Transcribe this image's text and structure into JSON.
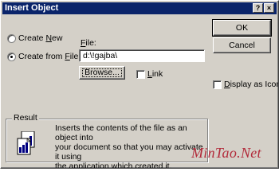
{
  "window": {
    "title": "Insert Object",
    "help_button": "?",
    "close_button": "×"
  },
  "buttons": {
    "ok": "OK",
    "cancel": "Cancel",
    "browse": "Browse..."
  },
  "options": {
    "create_new": {
      "prefix": "Create ",
      "accel": "N",
      "suffix": "ew",
      "selected": false
    },
    "create_from_file": {
      "prefix": "Create from ",
      "accel": "F",
      "suffix": "ile",
      "selected": true
    }
  },
  "file": {
    "label_accel": "F",
    "label_rest": "ile:",
    "value": "d:\\!gajba\\"
  },
  "link": {
    "accel": "L",
    "rest": "ink",
    "checked": false
  },
  "display_as_icon": {
    "accel": "D",
    "rest": "isplay as Icon",
    "checked": false
  },
  "result": {
    "title": "Result",
    "lines": [
      "Inserts the contents of the file as an object into",
      "your document so that you may activate it using",
      "the application which created it."
    ]
  },
  "watermark": "MinTao.Net"
}
